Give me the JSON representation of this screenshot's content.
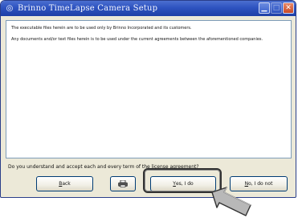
{
  "window": {
    "title": "Brinno TimeLapse Camera Setup",
    "controls": {
      "minimize": "▁",
      "maximize": "□",
      "close": "✕"
    }
  },
  "license": {
    "paragraphs": [
      "The executable files herein are to be used only by Brinno Incorporated and its customers.",
      "Any documents and/or text files herein is to be used under the current agreements between the aforementioned companies."
    ]
  },
  "prompt": "Do you understand and accept each and every term of the license agreement?",
  "buttons": {
    "back": {
      "accel": "B",
      "rest": "ack"
    },
    "print": {
      "icon": "printer-icon"
    },
    "yes": {
      "accel": "Y",
      "rest": "es, I do"
    },
    "no": {
      "accel": "N",
      "rest": "o, I do not"
    }
  },
  "colors": {
    "title_bar": "#2e53c0",
    "dialog_bg": "#ece9d8",
    "highlight_border": "#333333",
    "pointer_fill": "#b8b8b8"
  },
  "icons": {
    "app": "app-icon",
    "pointer": "hand-pointer-arrow-icon"
  }
}
